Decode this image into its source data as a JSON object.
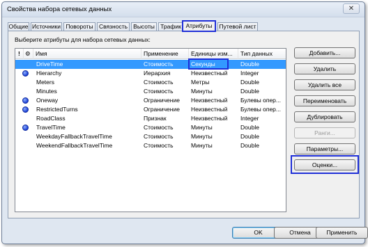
{
  "window": {
    "title": "Свойства набора сетевых данных",
    "close_glyph": "✕"
  },
  "tabs": [
    {
      "label": "Общие"
    },
    {
      "label": "Источники"
    },
    {
      "label": "Повороты"
    },
    {
      "label": "Связность"
    },
    {
      "label": "Высоты"
    },
    {
      "label": "Трафик"
    },
    {
      "label": "Атрибуты",
      "active": true
    },
    {
      "label": "Путевой лист"
    }
  ],
  "panel": {
    "instruction": "Выберите атрибуты для набора сетевых данных:"
  },
  "grid": {
    "header": {
      "warn": "!",
      "icon_col": "⚙",
      "name": "Имя",
      "usage": "Применение",
      "units": "Единицы изм...",
      "type": "Тип данных"
    },
    "rows": [
      {
        "icon": "",
        "name": "DriveTime",
        "usage": "Стоимость",
        "units": "Секунды",
        "type": "Double",
        "selected": true
      },
      {
        "icon": "default-icon",
        "name": "Hierarchy",
        "usage": "Иерархия",
        "units": "Неизвестный",
        "type": "Integer"
      },
      {
        "icon": "",
        "name": "Meters",
        "usage": "Стоимость",
        "units": "Метры",
        "type": "Double"
      },
      {
        "icon": "",
        "name": "Minutes",
        "usage": "Стоимость",
        "units": "Минуты",
        "type": "Double"
      },
      {
        "icon": "default-icon",
        "name": "Oneway",
        "usage": "Ограничение",
        "units": "Неизвестный",
        "type": "Булевы опер..."
      },
      {
        "icon": "default-icon",
        "name": "RestrictedTurns",
        "usage": "Ограничение",
        "units": "Неизвестный",
        "type": "Булевы опер..."
      },
      {
        "icon": "",
        "name": "RoadClass",
        "usage": "Признак",
        "units": "Неизвестный",
        "type": "Integer"
      },
      {
        "icon": "default-icon",
        "name": "TravelTime",
        "usage": "Стоимость",
        "units": "Минуты",
        "type": "Double"
      },
      {
        "icon": "",
        "name": "WeekdayFallbackTravelTime",
        "usage": "Стоимость",
        "units": "Минуты",
        "type": "Double"
      },
      {
        "icon": "",
        "name": "WeekendFallbackTravelTime",
        "usage": "Стоимость",
        "units": "Минуты",
        "type": "Double"
      }
    ]
  },
  "side_buttons": {
    "add": "Добавить...",
    "remove": "Удалить",
    "remove_all": "Удалить все",
    "rename": "Переименовать",
    "duplicate": "Дублировать",
    "ranges": "Ранги...",
    "parameters": "Параметры...",
    "evaluators": "Оценки..."
  },
  "footer": {
    "ok": "OK",
    "cancel": "Отмена",
    "apply": "Применить"
  },
  "colors": {
    "selection": "#3399ff",
    "highlight_outline": "#1f2fd8",
    "dialog_bg": "#dfe7f1"
  }
}
